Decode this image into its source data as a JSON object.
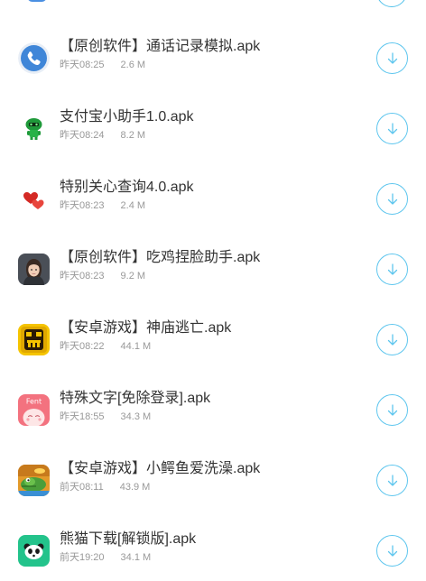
{
  "files": [
    {
      "title": "【原创软件】通话记录模拟.apk",
      "time": "昨天08:25",
      "size": "2.6 M",
      "icon": "phone-app-icon"
    },
    {
      "title": "支付宝小助手1.0.apk",
      "time": "昨天08:24",
      "size": "8.2 M",
      "icon": "green-robot-app-icon"
    },
    {
      "title": "特别关心查询4.0.apk",
      "time": "昨天08:23",
      "size": "2.4 M",
      "icon": "red-hearts-app-icon"
    },
    {
      "title": "【原创软件】吃鸡捏脸助手.apk",
      "time": "昨天08:23",
      "size": "9.2 M",
      "icon": "face-avatar-app-icon"
    },
    {
      "title": "【安卓游戏】神庙逃亡.apk",
      "time": "昨天08:22",
      "size": "44.1 M",
      "icon": "temple-run-app-icon"
    },
    {
      "title": "特殊文字[免除登录].apk",
      "time": "昨天18:55",
      "size": "34.3 M",
      "icon": "font-app-icon"
    },
    {
      "title": "【安卓游戏】小鳄鱼爱洗澡.apk",
      "time": "前天08:11",
      "size": "43.9 M",
      "icon": "crocodile-game-app-icon"
    },
    {
      "title": "熊猫下载[解锁版].apk",
      "time": "前天19:20",
      "size": "34.1 M",
      "icon": "panda-app-icon"
    }
  ],
  "colors": {
    "accent": "#5ec6ee",
    "title": "#333333",
    "meta": "#999999"
  },
  "icons": {
    "download": "download-arrow-icon"
  }
}
